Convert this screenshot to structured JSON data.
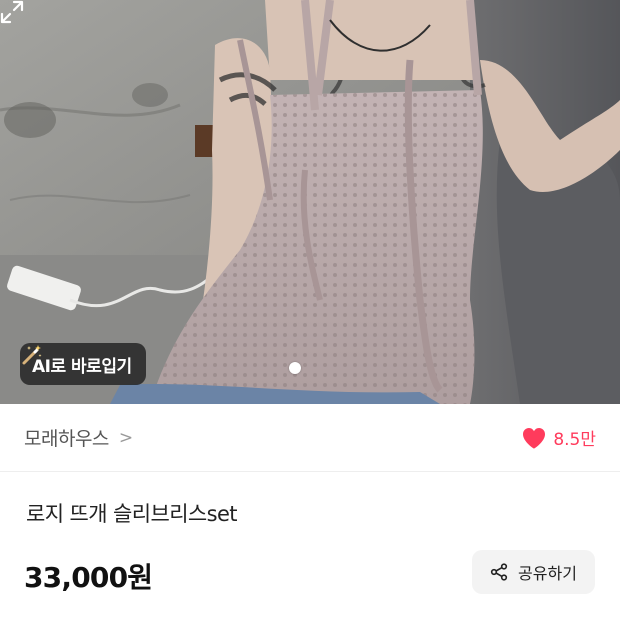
{
  "product_image": {
    "alt": "",
    "ai_button_label": "AI로 바로입기",
    "ai_icon": "magic-wand-icon",
    "expand_icon": "expand-icon",
    "carousel_total": 1,
    "carousel_current": 1
  },
  "store": {
    "name": "모래하우스",
    "chevron": ">",
    "like_icon": "heart-icon",
    "like_count": "8.5만"
  },
  "product": {
    "title": "로지 뜨개 슬리브리스set",
    "price": "33,000원"
  },
  "share": {
    "label": "공유하기",
    "icon": "share-icon"
  },
  "colors": {
    "accent": "#ff3b5c",
    "share_bg": "#f3f3f3"
  }
}
